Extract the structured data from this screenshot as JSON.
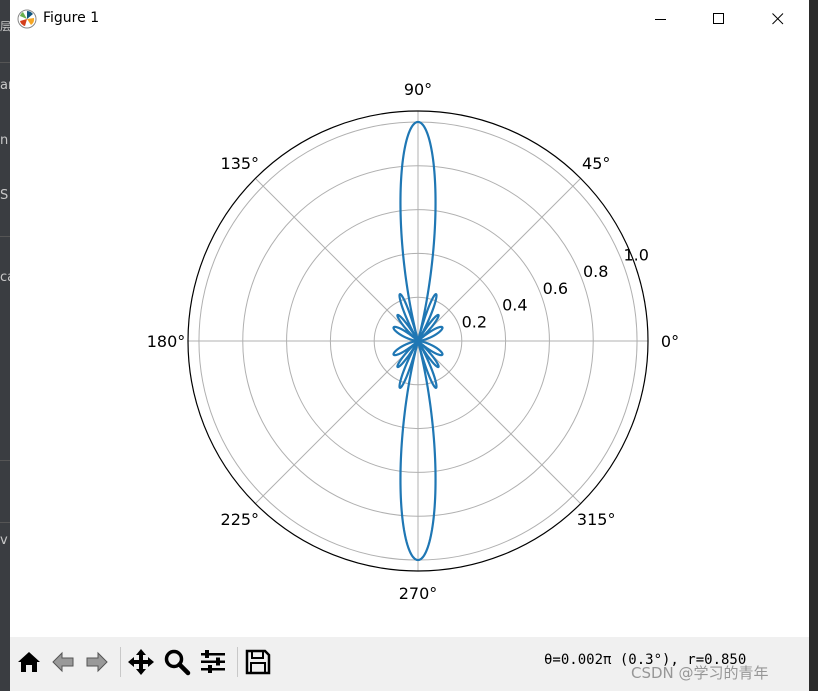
{
  "window": {
    "title": "Figure 1",
    "controls": {
      "minimize": "minimize",
      "maximize": "maximize",
      "close": "close"
    }
  },
  "background_app": {
    "visible_fragments": [
      "层",
      "ar",
      "n",
      "S",
      "ca",
      "v"
    ]
  },
  "chart_data": {
    "type": "line",
    "projection": "polar",
    "title": "",
    "angle_tick_labels": [
      "0°",
      "45°",
      "90°",
      "135°",
      "180°",
      "225°",
      "270°",
      "315°"
    ],
    "radial_tick_labels": [
      "0.2",
      "0.4",
      "0.6",
      "0.8",
      "1.0"
    ],
    "rlim": [
      0,
      1.05
    ],
    "grid": true,
    "series": [
      {
        "color": "#1f77b4",
        "function": "r = |cos(theta)^7|*0 + normalized array factor",
        "description_points": [
          {
            "theta_deg": 90,
            "r": 1.0
          },
          {
            "theta_deg": 270,
            "r": 1.0
          }
        ]
      }
    ]
  },
  "toolbar": {
    "tools": [
      {
        "name": "home",
        "icon": "home-icon"
      },
      {
        "name": "back",
        "icon": "back-arrow-icon"
      },
      {
        "name": "forward",
        "icon": "forward-arrow-icon"
      },
      {
        "name": "pan",
        "icon": "move-icon"
      },
      {
        "name": "zoom",
        "icon": "zoom-icon"
      },
      {
        "name": "configure",
        "icon": "sliders-icon"
      },
      {
        "name": "save",
        "icon": "save-icon"
      }
    ],
    "coordinates": "θ=0.002π (0.3°), r=0.850"
  },
  "watermark": "CSDN @学习的青年"
}
